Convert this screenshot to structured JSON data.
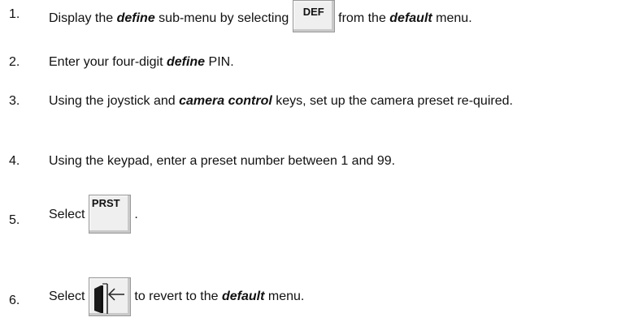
{
  "steps": [
    {
      "number": "1.",
      "parts": [
        "Display the ",
        "define",
        " sub-menu by selecting ",
        " from the ",
        "default",
        " menu."
      ],
      "key_label": "DEF"
    },
    {
      "number": "2.",
      "parts": [
        "Enter your four-digit ",
        "define",
        " PIN."
      ]
    },
    {
      "number": "3.",
      "parts": [
        "Using the joystick and ",
        "camera control",
        " keys, set up the camera preset re-quired."
      ]
    },
    {
      "number": "4.",
      "text": "Using the keypad, enter a preset number between 1 and 99."
    },
    {
      "number": "5.",
      "parts": [
        "Select ",
        " ."
      ],
      "key_label": "PRST"
    },
    {
      "number": "6.",
      "parts": [
        "Select ",
        " to revert to the ",
        "default",
        " menu."
      ],
      "icon": "exit-menu-icon"
    }
  ]
}
